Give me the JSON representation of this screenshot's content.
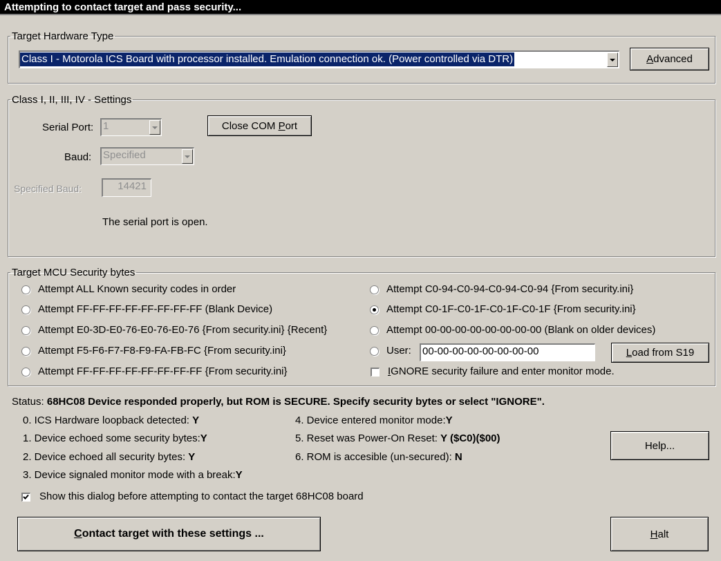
{
  "window": {
    "title": "Attempting to contact target and pass security..."
  },
  "hardware": {
    "legend": "Target Hardware Type",
    "selected": "Class I - Motorola ICS Board with processor installed. Emulation connection ok. (Power controlled via DTR)",
    "advanced_button_u": "A",
    "advanced_button_rest": "dvanced"
  },
  "settings": {
    "legend": "Class I, II, III, IV - Settings",
    "serial_port_label": "Serial Port:",
    "serial_port_value": "1",
    "close_com_pre": "Close COM ",
    "close_com_u": "P",
    "close_com_post": "ort",
    "baud_label": "Baud:",
    "baud_value": "Specified",
    "specified_baud_label": "Specified Baud:",
    "specified_baud_value": "14421",
    "port_status": "The serial port is open."
  },
  "security": {
    "legend": "Target MCU Security bytes",
    "left_options": [
      "Attempt ALL Known security codes in order",
      "Attempt FF-FF-FF-FF-FF-FF-FF-FF (Blank Device)",
      "Attempt E0-3D-E0-76-E0-76-E0-76 {From security.ini} {Recent}",
      "Attempt F5-F6-F7-F8-F9-FA-FB-FC {From security.ini}",
      "Attempt FF-FF-FF-FF-FF-FF-FF-FF {From security.ini}"
    ],
    "right_options": [
      "Attempt C0-94-C0-94-C0-94-C0-94 {From security.ini}",
      "Attempt C0-1F-C0-1F-C0-1F-C0-1F {From security.ini}",
      "Attempt 00-00-00-00-00-00-00-00 (Blank on older devices)"
    ],
    "user_label": "User:",
    "user_value": "00-00-00-00-00-00-00-00",
    "load_button_u": "L",
    "load_button_rest": "oad from S19",
    "ignore_u": "I",
    "ignore_rest": "GNORE security failure and enter monitor mode."
  },
  "status": {
    "label": "Status:",
    "message": "68HC08 Device responded properly, but ROM is SECURE. Specify security bytes or select \"IGNORE\".",
    "left_items": [
      {
        "label": "0. ICS Hardware loopback detected:",
        "value": "Y"
      },
      {
        "label": "1. Device echoed some security bytes:",
        "value": "Y"
      },
      {
        "label": "2. Device echoed all security bytes:",
        "value": "Y"
      },
      {
        "label": "3. Device signaled monitor mode with a break:",
        "value": "Y"
      }
    ],
    "right_items": [
      {
        "label": "4. Device entered monitor mode:",
        "value": "Y"
      },
      {
        "label": "5. Reset was Power-On Reset:",
        "value": "Y ($C0)($00)"
      },
      {
        "label": "6. ROM is accesible (un-secured):",
        "value": "N"
      }
    ],
    "help_button": "Help..."
  },
  "show_dialog_label": "Show this dialog before attempting to contact the target 68HC08 board",
  "contact_button_u": "C",
  "contact_button_rest": "ontact target with these settings ...",
  "halt_button_u": "H",
  "halt_button_rest": "alt"
}
